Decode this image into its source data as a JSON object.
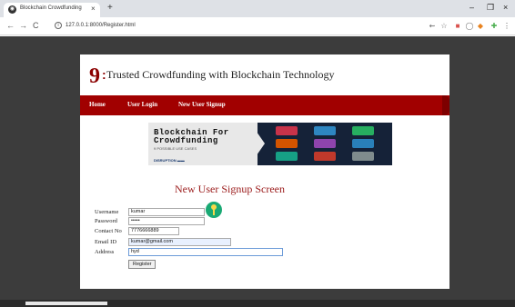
{
  "browser": {
    "tab_title": "Blockchain Crowdfunding",
    "tab_close": "×",
    "new_tab": "+",
    "favicon": "◉",
    "url": "127.0.0.1:8000/Register.html",
    "nav": {
      "back": "←",
      "forward": "→",
      "reload": "C",
      "info": "i"
    },
    "window": {
      "minimize": "–",
      "maximize": "❐",
      "close": "×"
    },
    "toolbar_icons": [
      {
        "icon": "key-icon",
        "glyph": "⇜",
        "color": "#666666"
      },
      {
        "icon": "star-icon",
        "glyph": "☆",
        "color": "#666666"
      },
      {
        "icon": "extension-red-icon",
        "glyph": "■",
        "color": "#d9534f"
      },
      {
        "icon": "extension-gray-icon",
        "glyph": "◯",
        "color": "#777777"
      },
      {
        "icon": "extension-fox-icon",
        "glyph": "◆",
        "color": "#e8821e"
      },
      {
        "icon": "extension-puzzle-icon",
        "glyph": "✚",
        "color": "#4caf50"
      },
      {
        "icon": "menu-icon",
        "glyph": "⋮",
        "color": "#555555"
      }
    ]
  },
  "site": {
    "logo_mark": "9",
    "logo_colon": ":",
    "title": "Trusted Crowdfunding with Blockchain Technology",
    "menu": [
      {
        "label": "Home"
      },
      {
        "label": "User Login"
      },
      {
        "label": "New User Signup"
      }
    ],
    "banner": {
      "line1": "Blockchain For",
      "line2": "Crowdfunding",
      "sub": "9 POSSIBLE USE CASES",
      "foot": "DISRUPTION ▬▬"
    },
    "colors": {
      "brand": "#a10000",
      "heading": "#9b1b1b"
    }
  },
  "form": {
    "heading": "New User Signup Screen",
    "fields": [
      {
        "label": "Username",
        "value": "kumar"
      },
      {
        "label": "Password",
        "value": "•••••"
      },
      {
        "label": "Contact No",
        "value": "7776666889"
      },
      {
        "label": "Email ID",
        "value": "kumar@gmail.com"
      },
      {
        "label": "Address",
        "value": "hyd"
      }
    ],
    "submit_label": "Register"
  }
}
